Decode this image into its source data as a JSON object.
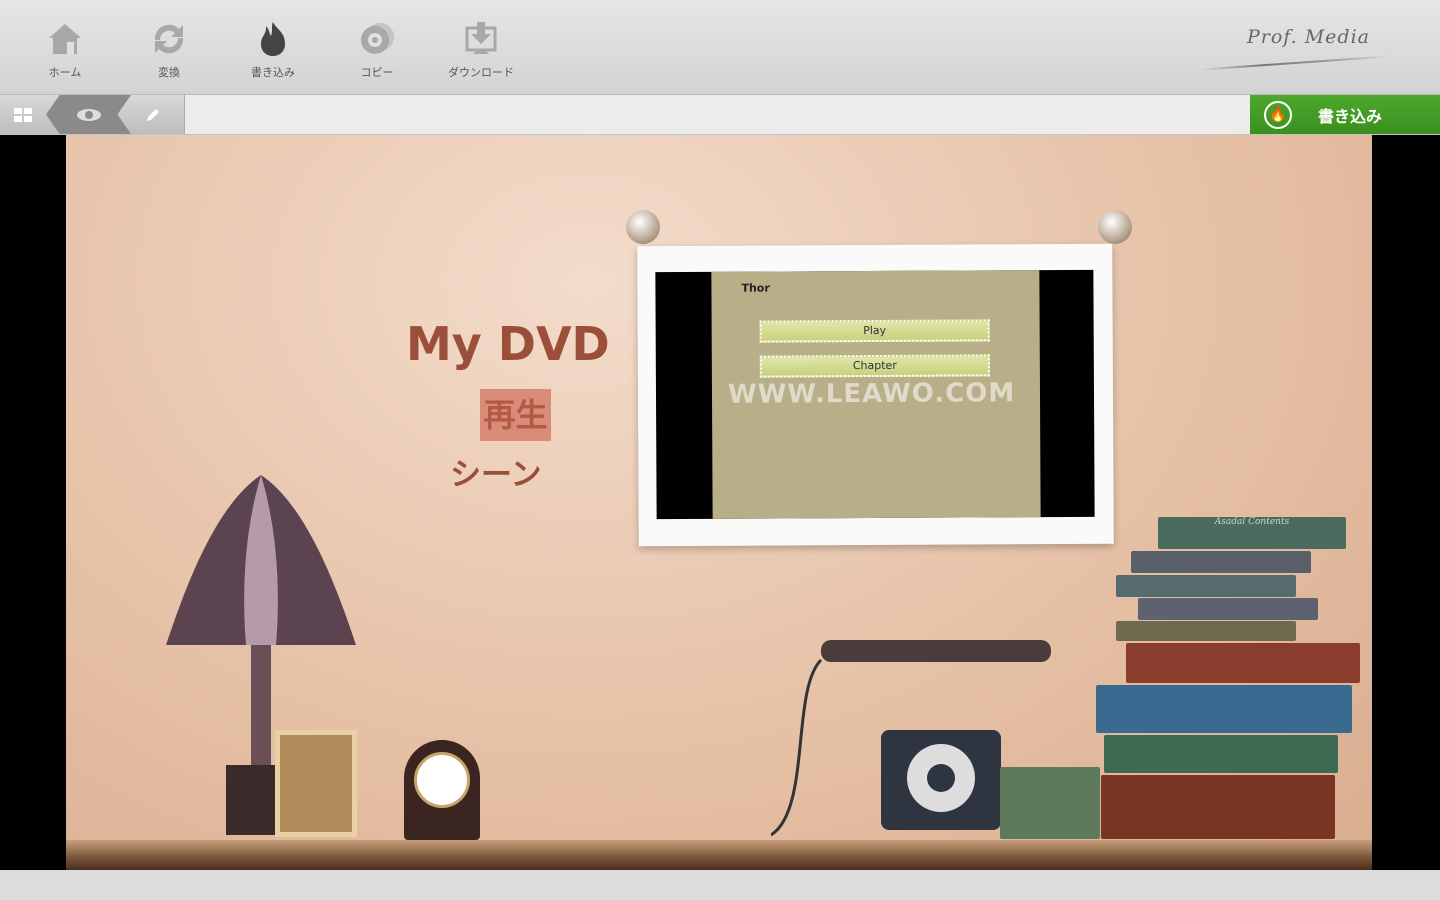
{
  "toolbar": {
    "items": [
      {
        "label": "ホーム",
        "icon": "home-icon"
      },
      {
        "label": "変換",
        "icon": "convert-icon"
      },
      {
        "label": "書き込み",
        "icon": "burn-icon"
      },
      {
        "label": "コピー",
        "icon": "copy-icon"
      },
      {
        "label": "ダウンロード",
        "icon": "download-icon"
      }
    ],
    "logo": "Prof. Media"
  },
  "actionbar": {
    "burn_label": "書き込み"
  },
  "preview": {
    "title": "My DVD",
    "play": "再生",
    "scene": "シーン",
    "thumbnail": {
      "title": "Thor",
      "buttons": [
        "Play",
        "Chapter"
      ],
      "watermark": "WWW.LEAWO.COM"
    },
    "books": [
      "Asadal Contents"
    ]
  },
  "colors": {
    "accent": "#45a024",
    "title": "#9b4e3a"
  }
}
